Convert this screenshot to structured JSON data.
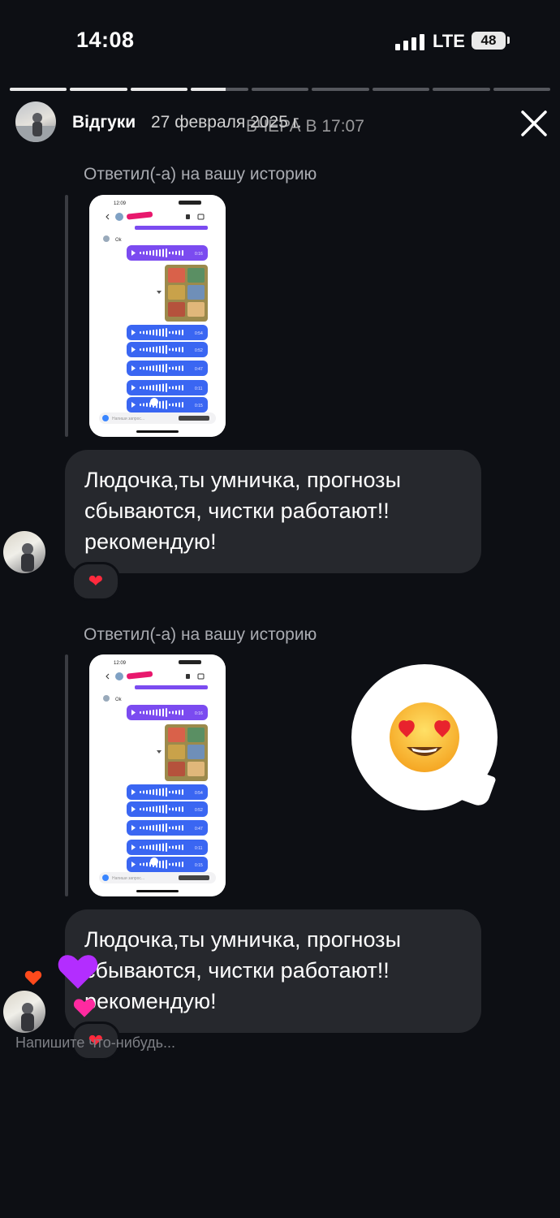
{
  "status_bar": {
    "time": "14:08",
    "network": "LTE",
    "battery": "48"
  },
  "story": {
    "segments_total": 9,
    "segments_completed": 3,
    "current_segment_progress": 0.6,
    "author": "Відгуки",
    "date": "27 февраля 2025 г.",
    "overlay_timestamp": "ВЧЕРА В 17:07"
  },
  "messages": [
    {
      "reply_label": "Ответил(-а) на вашу историю",
      "text": "Людочка,ты умничка, прогнозы сбываются, чистки работают!! рекомендую!",
      "reaction": "❤"
    },
    {
      "reply_label": "Ответил(-а) на вашу историю",
      "text": "Людочка,ты умничка, прогнозы сбываются, чистки работают!! рекомендую!",
      "reaction": "❤",
      "sticker": "😍"
    }
  ],
  "thumbnail": {
    "time": "12:09",
    "message": "Ok",
    "durations": [
      "0:16",
      "0:54",
      "0:52",
      "0:47",
      "0:11",
      "0:15"
    ],
    "input_placeholder": "Напиши запрос..."
  },
  "floating_hearts": [
    "❤",
    "💜",
    "💗"
  ],
  "composer": {
    "placeholder": "Напишите что-нибудь..."
  },
  "colors": {
    "background": "#0d0f14",
    "bubble": "#26282d",
    "voice_purple": "#7b4bf0",
    "voice_blue": "#3a66f2"
  }
}
